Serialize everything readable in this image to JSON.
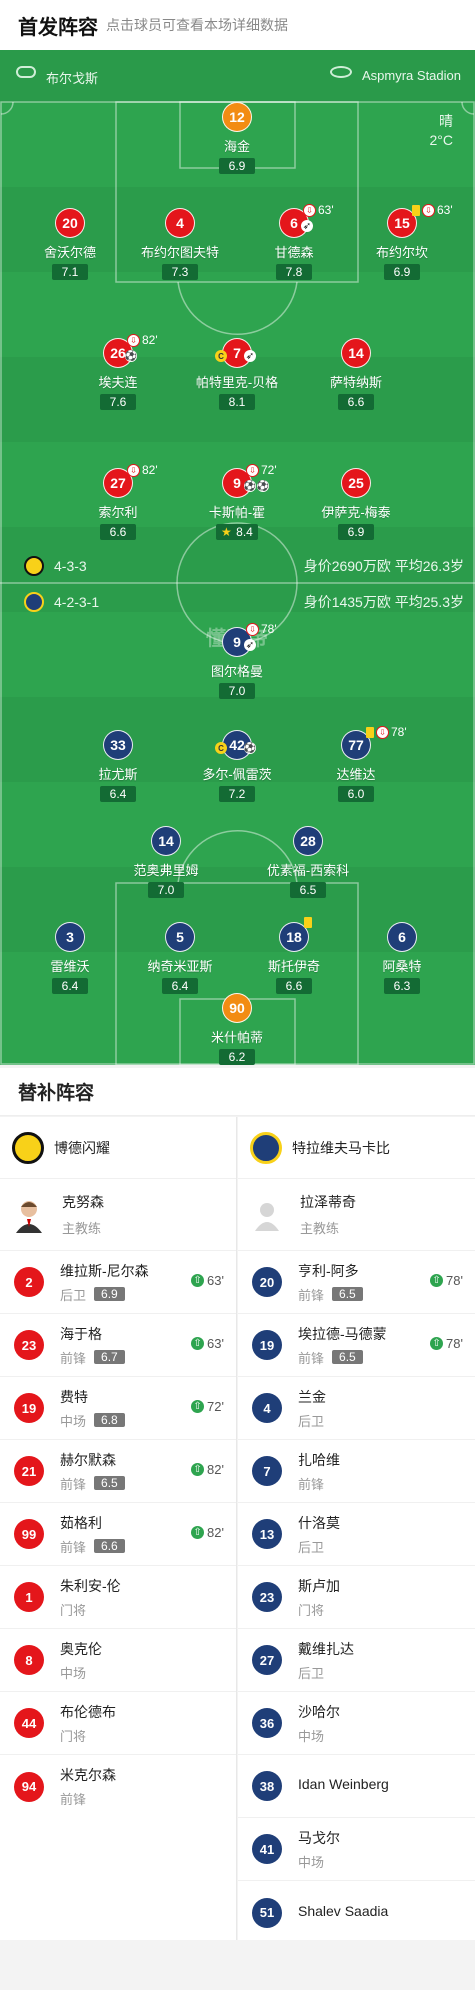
{
  "header": {
    "title": "首发阵容",
    "subtitle": "点击球员可查看本场详细数据"
  },
  "venue": {
    "referee": "布尔戈斯",
    "stadium": "Aspmyra Stadion"
  },
  "weather": {
    "condition": "晴",
    "temperature": "2°C"
  },
  "teams": {
    "home": {
      "formation": "4-3-3",
      "value": "身价2690万欧 平均26.3岁",
      "color": "#e4161b"
    },
    "away": {
      "formation": "4-2-3-1",
      "value": "身价1435万欧 平均25.3岁",
      "color": "#1f3e78"
    }
  },
  "watermark": "懂球帝",
  "home_players": [
    {
      "no": "12",
      "name": "海金",
      "rating": "6.9"
    },
    {
      "no": "20",
      "name": "舍沃尔德",
      "rating": "7.1"
    },
    {
      "no": "4",
      "name": "布约尔图夫特",
      "rating": "7.3"
    },
    {
      "no": "6",
      "name": "甘德森",
      "rating": "7.8",
      "event": "63'"
    },
    {
      "no": "15",
      "name": "布约尔坎",
      "rating": "6.9",
      "event": "63'"
    },
    {
      "no": "26",
      "name": "埃夫连",
      "rating": "7.6",
      "event": "82'"
    },
    {
      "no": "7",
      "name": "帕特里克-贝格",
      "rating": "8.1",
      "captain": "C"
    },
    {
      "no": "14",
      "name": "萨特纳斯",
      "rating": "6.6"
    },
    {
      "no": "27",
      "name": "索尔利",
      "rating": "6.6",
      "event": "82'"
    },
    {
      "no": "9",
      "name": "卡斯帕-霍",
      "rating": "8.4",
      "event": "72'"
    },
    {
      "no": "25",
      "name": "伊萨克-梅泰",
      "rating": "6.9"
    }
  ],
  "away_players": [
    {
      "no": "9",
      "name": "图尔格曼",
      "rating": "7.0",
      "event": "78'"
    },
    {
      "no": "33",
      "name": "拉尤斯",
      "rating": "6.4"
    },
    {
      "no": "42",
      "name": "多尔-佩雷茨",
      "rating": "7.2",
      "captain": "C"
    },
    {
      "no": "77",
      "name": "达维达",
      "rating": "6.0",
      "event": "78'"
    },
    {
      "no": "14",
      "name": "范奥弗里姆",
      "rating": "7.0"
    },
    {
      "no": "28",
      "name": "优素福-西索科",
      "rating": "6.5"
    },
    {
      "no": "3",
      "name": "雷维沃",
      "rating": "6.4"
    },
    {
      "no": "5",
      "name": "纳奇米亚斯",
      "rating": "6.4"
    },
    {
      "no": "18",
      "name": "斯托伊奇",
      "rating": "6.6"
    },
    {
      "no": "6",
      "name": "阿桑特",
      "rating": "6.3"
    },
    {
      "no": "90",
      "name": "米什帕蒂",
      "rating": "6.2"
    }
  ],
  "subs": {
    "title": "替补阵容",
    "home": {
      "club": "博德闪耀",
      "coach": {
        "name": "克努森",
        "role": "主教练"
      },
      "players": [
        {
          "no": "2",
          "name": "维拉斯-尼尔森",
          "pos": "后卫",
          "rating": "6.9",
          "in": "63'"
        },
        {
          "no": "23",
          "name": "海于格",
          "pos": "前锋",
          "rating": "6.7",
          "in": "63'"
        },
        {
          "no": "19",
          "name": "费特",
          "pos": "中场",
          "rating": "6.8",
          "in": "72'"
        },
        {
          "no": "21",
          "name": "赫尔默森",
          "pos": "前锋",
          "rating": "6.5",
          "in": "82'"
        },
        {
          "no": "99",
          "name": "茹格利",
          "pos": "前锋",
          "rating": "6.6",
          "in": "82'"
        },
        {
          "no": "1",
          "name": "朱利安-伦",
          "pos": "门将"
        },
        {
          "no": "8",
          "name": "奥克伦",
          "pos": "中场"
        },
        {
          "no": "44",
          "name": "布伦德布",
          "pos": "门将"
        },
        {
          "no": "94",
          "name": "米克尔森",
          "pos": "前锋"
        }
      ]
    },
    "away": {
      "club": "特拉维夫马卡比",
      "coach": {
        "name": "拉泽蒂奇",
        "role": "主教练"
      },
      "players": [
        {
          "no": "20",
          "name": "亨利-阿多",
          "pos": "前锋",
          "rating": "6.5",
          "in": "78'"
        },
        {
          "no": "19",
          "name": "埃拉德-马德蒙",
          "pos": "前锋",
          "rating": "6.5",
          "in": "78'"
        },
        {
          "no": "4",
          "name": "兰金",
          "pos": "后卫"
        },
        {
          "no": "7",
          "name": "扎哈维",
          "pos": "前锋"
        },
        {
          "no": "13",
          "name": "什洛莫",
          "pos": "后卫"
        },
        {
          "no": "23",
          "name": "斯卢加",
          "pos": "门将"
        },
        {
          "no": "27",
          "name": "戴维扎达",
          "pos": "后卫"
        },
        {
          "no": "36",
          "name": "沙哈尔",
          "pos": "中场"
        },
        {
          "no": "38",
          "name": "Idan Weinberg",
          "pos": ""
        },
        {
          "no": "41",
          "name": "马戈尔",
          "pos": "中场"
        },
        {
          "no": "51",
          "name": "Shalev Saadia",
          "pos": ""
        }
      ]
    }
  }
}
